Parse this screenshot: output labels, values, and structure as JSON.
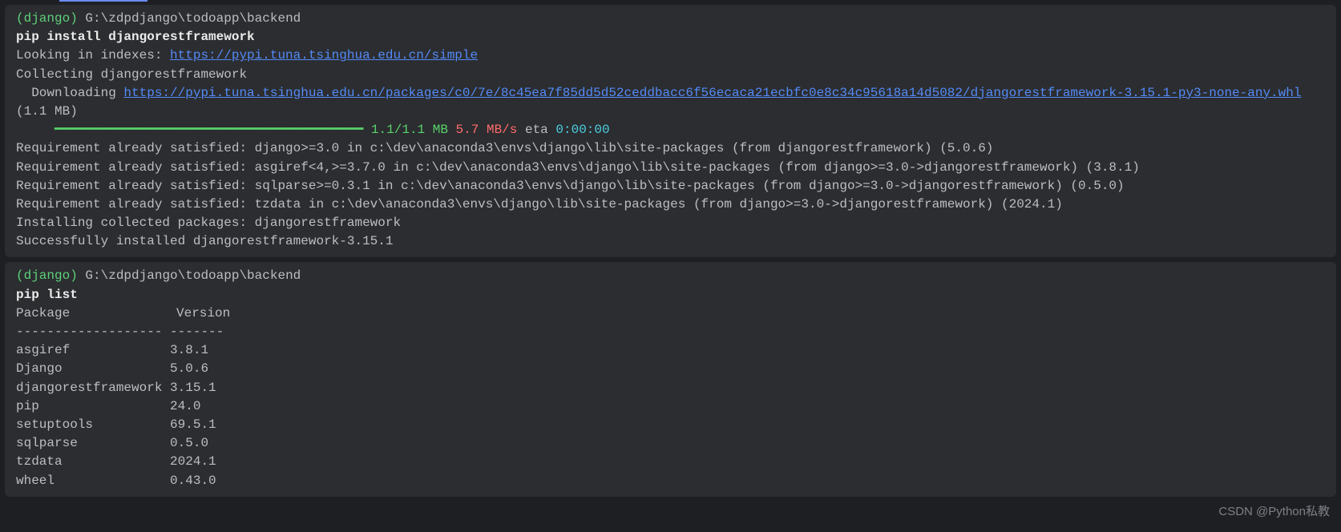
{
  "block1": {
    "env": "(django)",
    "cwd": "G:\\zdpdjango\\todoapp\\backend",
    "cmd": "pip install djangorestframework",
    "looking_label": "Looking in indexes: ",
    "index_url": "https://pypi.tuna.tsinghua.edu.cn/simple",
    "collecting": "Collecting djangorestframework",
    "downloading_label": "  Downloading ",
    "download_url": "https://pypi.tuna.tsinghua.edu.cn/packages/c0/7e/8c45ea7f85dd5d52ceddbacc6f56ecaca21ecbfc0e8c34c95618a14d5082/djangorestframework-3.15.1-py3-none-any.whl",
    "download_size_suffix": " (1.1 MB)",
    "progress_bar": "     ━━━━━━━━━━━━━━━━━━━━━━━━━━━━━━━━━━━━━━━━",
    "progress_size": " 1.1/1.1 MB",
    "progress_speed": " 5.7 MB/s",
    "progress_eta_label": " eta ",
    "progress_eta": "0:00:00",
    "req1": "Requirement already satisfied: django>=3.0 in c:\\dev\\anaconda3\\envs\\django\\lib\\site-packages (from djangorestframework) (5.0.6)",
    "req2": "Requirement already satisfied: asgiref<4,>=3.7.0 in c:\\dev\\anaconda3\\envs\\django\\lib\\site-packages (from django>=3.0->djangorestframework) (3.8.1)",
    "req3": "Requirement already satisfied: sqlparse>=0.3.1 in c:\\dev\\anaconda3\\envs\\django\\lib\\site-packages (from django>=3.0->djangorestframework) (0.5.0)",
    "req4": "Requirement already satisfied: tzdata in c:\\dev\\anaconda3\\envs\\django\\lib\\site-packages (from django>=3.0->djangorestframework) (2024.1)",
    "installing": "Installing collected packages: djangorestframework",
    "success": "Successfully installed djangorestframework-3.15.1"
  },
  "block2": {
    "env": "(django)",
    "cwd": "G:\\zdpdjango\\todoapp\\backend",
    "cmd": "pip list",
    "header_pkg": "Package",
    "header_ver": "Version",
    "divider": "------------------- -------",
    "rows": [
      {
        "name": "asgiref",
        "version": "3.8.1"
      },
      {
        "name": "Django",
        "version": "5.0.6"
      },
      {
        "name": "djangorestframework",
        "version": "3.15.1"
      },
      {
        "name": "pip",
        "version": "24.0"
      },
      {
        "name": "setuptools",
        "version": "69.5.1"
      },
      {
        "name": "sqlparse",
        "version": "0.5.0"
      },
      {
        "name": "tzdata",
        "version": "2024.1"
      },
      {
        "name": "wheel",
        "version": "0.43.0"
      }
    ]
  },
  "watermark": "CSDN @Python私教"
}
